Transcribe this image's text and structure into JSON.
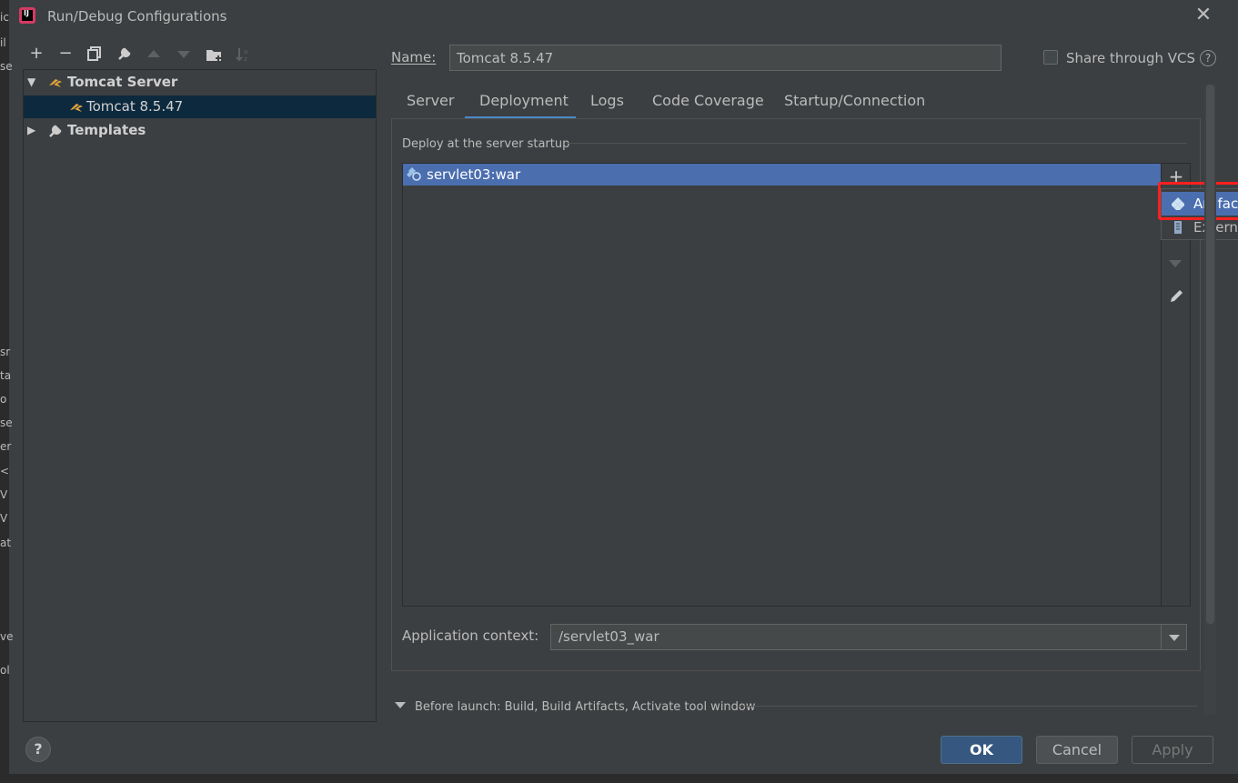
{
  "window": {
    "title": "Run/Debug Configurations",
    "app_icon_label": "IJ"
  },
  "background_fragments": [
    "ic",
    "il",
    "se",
    "sr",
    "ta",
    "o",
    "se",
    "er",
    "<",
    "V",
    "V",
    "at",
    "ve",
    "ol"
  ],
  "toolbar": {
    "add": "+",
    "remove": "−",
    "copy": "⧉",
    "wrench": "🔧",
    "up": "▲",
    "down": "▼",
    "folder": "▣",
    "sort": "↓ᵃz"
  },
  "tree": {
    "items": [
      {
        "label": "Tomcat Server",
        "expanded": true
      },
      {
        "label": "Tomcat 8.5.47",
        "selected": true
      },
      {
        "label": "Templates",
        "expanded": false
      }
    ]
  },
  "help": "?",
  "name_field": {
    "label": "Name:",
    "value": "Tomcat 8.5.47"
  },
  "share_vcs": {
    "label": "Share through VCS",
    "checked": false,
    "help": "?"
  },
  "tabs": [
    {
      "label": "Server"
    },
    {
      "label": "Deployment",
      "active": true
    },
    {
      "label": "Logs"
    },
    {
      "label": "Code Coverage"
    },
    {
      "label": "Startup/Connection"
    }
  ],
  "deployment": {
    "group_title": "Deploy at the server startup",
    "items": [
      {
        "label": "servlet03:war"
      }
    ],
    "add": "+"
  },
  "popup": {
    "items": [
      {
        "label": "Artifac"
      },
      {
        "label": "Externa"
      }
    ]
  },
  "app_context": {
    "label": "Application context:",
    "value": "/servlet03_war"
  },
  "before_launch": {
    "label": "Before launch: Build, Build Artifacts, Activate tool window"
  },
  "buttons": {
    "ok": "OK",
    "cancel": "Cancel",
    "apply": "Apply"
  },
  "colors": {
    "accent": "#4b6eaf",
    "ok_button": "#365880",
    "highlight_box": "#ff2020",
    "selected_tree": "#0d293e"
  }
}
